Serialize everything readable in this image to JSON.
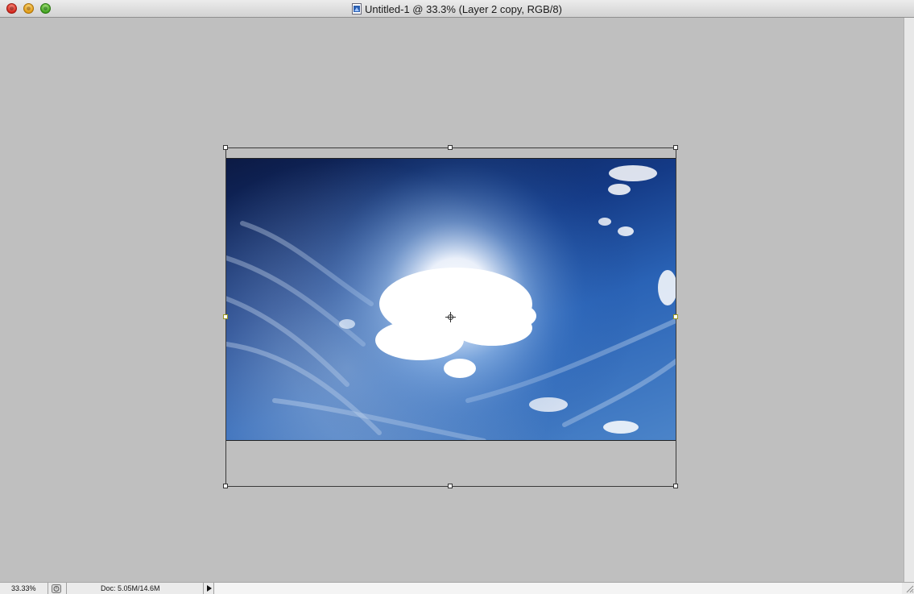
{
  "window": {
    "title": "Untitled-1 @ 33.3% (Layer 2 copy, RGB/8)"
  },
  "controls": {
    "close": "close-button",
    "minimize": "minimize-button",
    "zoom": "zoom-button"
  },
  "canvas": {
    "layer_name": "Layer 2 copy",
    "image_subject": "sky-with-sun-and-clouds"
  },
  "status_bar": {
    "zoom": "33.33%",
    "doc_info": "Doc: 5.05M/14.6M"
  },
  "icons": {
    "document": "photoshop-document-icon",
    "status": "status-indicator-icon",
    "menu": "triangle-right-icon"
  },
  "colors": {
    "canvas_background": "#bfbfbf",
    "sky_dark": "#0c1a44",
    "sky_light": "#4b84c9"
  }
}
